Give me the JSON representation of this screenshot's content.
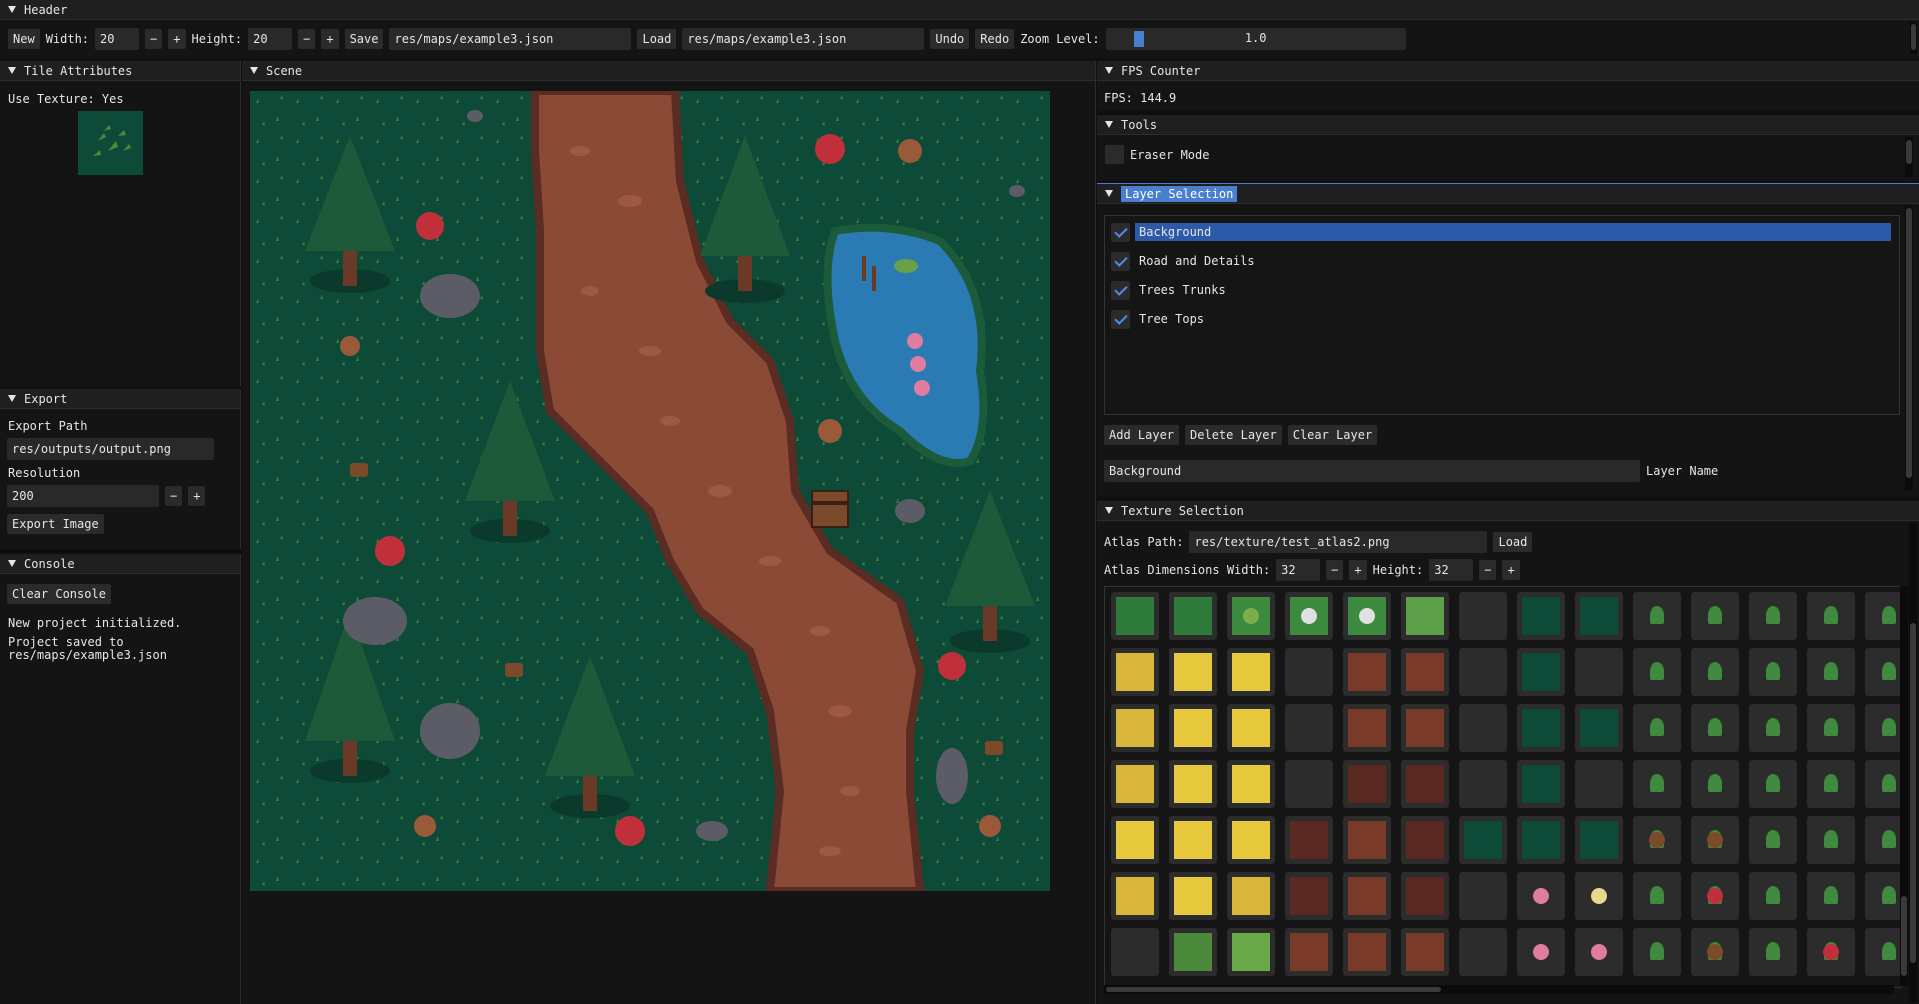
{
  "header": {
    "title": "Header",
    "new_label": "New",
    "width_label": "Width:",
    "width_value": "20",
    "height_label": "Height:",
    "height_value": "20",
    "minus": "−",
    "plus": "+",
    "save_label": "Save",
    "save_path": "res/maps/example3.json",
    "load_label": "Load",
    "load_path": "res/maps/example3.json",
    "undo_label": "Undo",
    "redo_label": "Redo",
    "zoom_label": "Zoom Level:",
    "zoom_value": "1.0",
    "zoom_fraction": 0.03
  },
  "tile_attributes": {
    "title": "Tile Attributes",
    "use_texture": "Use Texture: Yes",
    "preview_icon": "grass-sprout-tile"
  },
  "export": {
    "title": "Export",
    "path_label": "Export Path",
    "path_value": "res/outputs/output.png",
    "resolution_label": "Resolution",
    "resolution_value": "200",
    "minus": "−",
    "plus": "+",
    "export_button": "Export Image"
  },
  "console": {
    "title": "Console",
    "clear_button": "Clear Console",
    "lines": [
      "New project initialized.",
      "Project saved to",
      "res/maps/example3.json"
    ]
  },
  "scene": {
    "title": "Scene",
    "map_description_icons": [
      "pine-tree",
      "mushroom",
      "rock",
      "pond",
      "dirt-path",
      "treasure-chest",
      "tree-stump",
      "water-lily"
    ]
  },
  "fps": {
    "title": "FPS Counter",
    "value": "FPS: 144.9"
  },
  "tools": {
    "title": "Tools",
    "eraser_label": "Eraser Mode"
  },
  "layers": {
    "title": "Layer Selection",
    "items": [
      {
        "label": "Background",
        "checked": true,
        "selected": true
      },
      {
        "label": "Road and Details",
        "checked": true,
        "selected": false
      },
      {
        "label": "Trees Trunks",
        "checked": true,
        "selected": false
      },
      {
        "label": "Tree Tops",
        "checked": true,
        "selected": false
      }
    ],
    "add_button": "Add Layer",
    "delete_button": "Delete Layer",
    "clear_button": "Clear Layer",
    "name_value": "Background",
    "name_label": "Layer Name"
  },
  "textures": {
    "title": "Texture Selection",
    "atlas_path_label": "Atlas Path:",
    "atlas_path_value": "res/texture/test_atlas2.png",
    "load_button": "Load",
    "dims_label": "Atlas Dimensions Width:",
    "width_value": "32",
    "height_label": "Height:",
    "height_value": "32",
    "minus": "−",
    "plus": "+"
  },
  "colors": {
    "grass": "#0e4a38",
    "path": "#8a4a35",
    "water": "#2a7ab4",
    "accent": "#4a7fd0",
    "panel_bg": "#141414"
  }
}
